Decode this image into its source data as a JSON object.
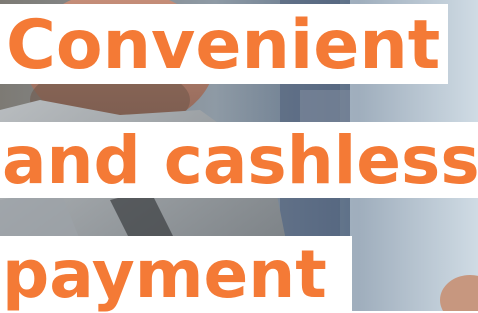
{
  "headline": {
    "line1": "Convenient",
    "line2": "and cashless",
    "line3": "payment"
  },
  "colors": {
    "headline_text": "#f47a36",
    "band_background": "#ffffff"
  }
}
